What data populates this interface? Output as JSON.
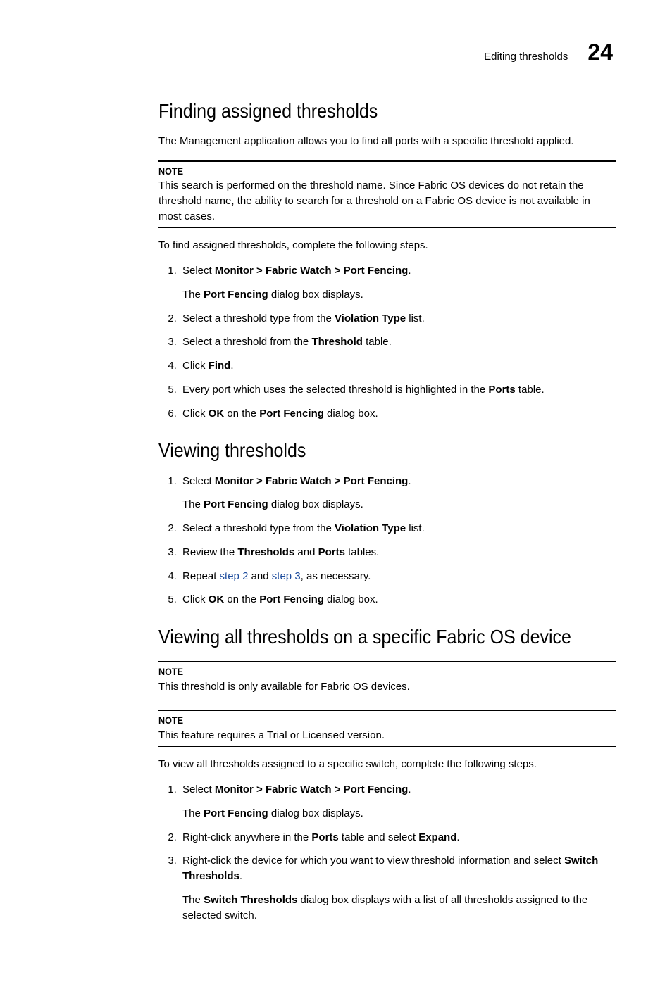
{
  "header": {
    "running_text": "Editing thresholds",
    "chapter_number": "24"
  },
  "section1": {
    "heading": "Finding assigned thresholds",
    "intro": "The Management application allows you to find all ports with a specific threshold applied.",
    "note_label": "NOTE",
    "note_body": "This search is performed on the threshold name. Since Fabric OS devices do not retain the threshold name, the ability to search for a threshold on a Fabric OS device is not available in most cases.",
    "lead_in": "To find assigned thresholds, complete the following steps.",
    "steps": {
      "s1_a": "Select ",
      "s1_b": "Monitor > Fabric Watch > Port Fencing",
      "s1_c": ".",
      "s1_sub_a": "The ",
      "s1_sub_b": "Port Fencing",
      "s1_sub_c": " dialog box displays.",
      "s2_a": "Select a threshold type from the ",
      "s2_b": "Violation Type",
      "s2_c": " list.",
      "s3_a": "Select a threshold from the ",
      "s3_b": "Threshold",
      "s3_c": " table.",
      "s4_a": "Click ",
      "s4_b": "Find",
      "s4_c": ".",
      "s5_a": "Every port which uses the selected threshold is highlighted in the ",
      "s5_b": "Ports",
      "s5_c": " table.",
      "s6_a": "Click ",
      "s6_b": "OK",
      "s6_c": " on the ",
      "s6_d": "Port Fencing",
      "s6_e": " dialog box."
    }
  },
  "section2": {
    "heading": "Viewing thresholds",
    "steps": {
      "s1_a": "Select ",
      "s1_b": "Monitor > Fabric Watch > Port Fencing",
      "s1_c": ".",
      "s1_sub_a": "The ",
      "s1_sub_b": "Port Fencing",
      "s1_sub_c": " dialog box displays.",
      "s2_a": "Select a threshold type from the ",
      "s2_b": "Violation Type",
      "s2_c": " list.",
      "s3_a": "Review the ",
      "s3_b": "Thresholds",
      "s3_c": " and ",
      "s3_d": "Ports",
      "s3_e": " tables.",
      "s4_a": "Repeat ",
      "s4_b": "step 2",
      "s4_c": " and ",
      "s4_d": "step 3",
      "s4_e": ", as necessary.",
      "s5_a": "Click ",
      "s5_b": "OK",
      "s5_c": " on the ",
      "s5_d": "Port Fencing",
      "s5_e": " dialog box."
    }
  },
  "section3": {
    "heading": "Viewing all thresholds on a specific Fabric OS device",
    "note1_label": "NOTE",
    "note1_body": "This threshold is only available for Fabric OS devices.",
    "note2_label": "NOTE",
    "note2_body": "This feature requires a Trial or Licensed version.",
    "lead_in": "To view all thresholds assigned to a specific switch, complete the following steps.",
    "steps": {
      "s1_a": "Select ",
      "s1_b": "Monitor > Fabric Watch > Port Fencing",
      "s1_c": ".",
      "s1_sub_a": "The ",
      "s1_sub_b": "Port Fencing",
      "s1_sub_c": " dialog box displays.",
      "s2_a": "Right-click anywhere in the ",
      "s2_b": "Ports",
      "s2_c": " table and select ",
      "s2_d": "Expand",
      "s2_e": ".",
      "s3_a": "Right-click the device for which you want to view threshold information and select ",
      "s3_b": "Switch Thresholds",
      "s3_c": ".",
      "s3_sub_a": "The ",
      "s3_sub_b": "Switch Thresholds",
      "s3_sub_c": " dialog box displays with a list of all thresholds assigned to the selected switch."
    }
  }
}
